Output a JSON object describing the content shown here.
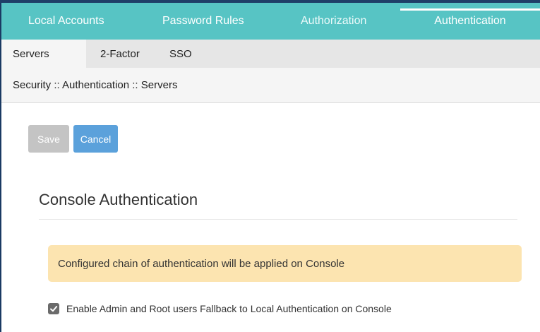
{
  "main_tabs": [
    {
      "label": "Local Accounts",
      "active": false
    },
    {
      "label": "Password Rules",
      "active": false
    },
    {
      "label": "Authorization",
      "active": false
    },
    {
      "label": "Authentication",
      "active": true
    }
  ],
  "sub_tabs": [
    {
      "label": "Servers",
      "active": true
    },
    {
      "label": "2-Factor",
      "active": false
    },
    {
      "label": "SSO",
      "active": false
    }
  ],
  "breadcrumb": "Security :: Authentication :: Servers",
  "actions": {
    "save_label": "Save",
    "cancel_label": "Cancel"
  },
  "section": {
    "title": "Console Authentication"
  },
  "alert": {
    "text": "Configured chain of authentication will be applied on Console"
  },
  "fallback_option": {
    "label": "Enable Admin and Root users Fallback to Local Authentication on Console",
    "checked": true
  },
  "colors": {
    "tab_bar": "#57c4c4",
    "subtab_bar": "#e6e6e6",
    "cancel_button": "#5ba1db",
    "save_button_disabled": "#c4c4c4",
    "alert_background": "#fce4b0",
    "checkbox": "#6b6b6b"
  },
  "icons": {
    "checkbox": "checkmark-icon"
  }
}
